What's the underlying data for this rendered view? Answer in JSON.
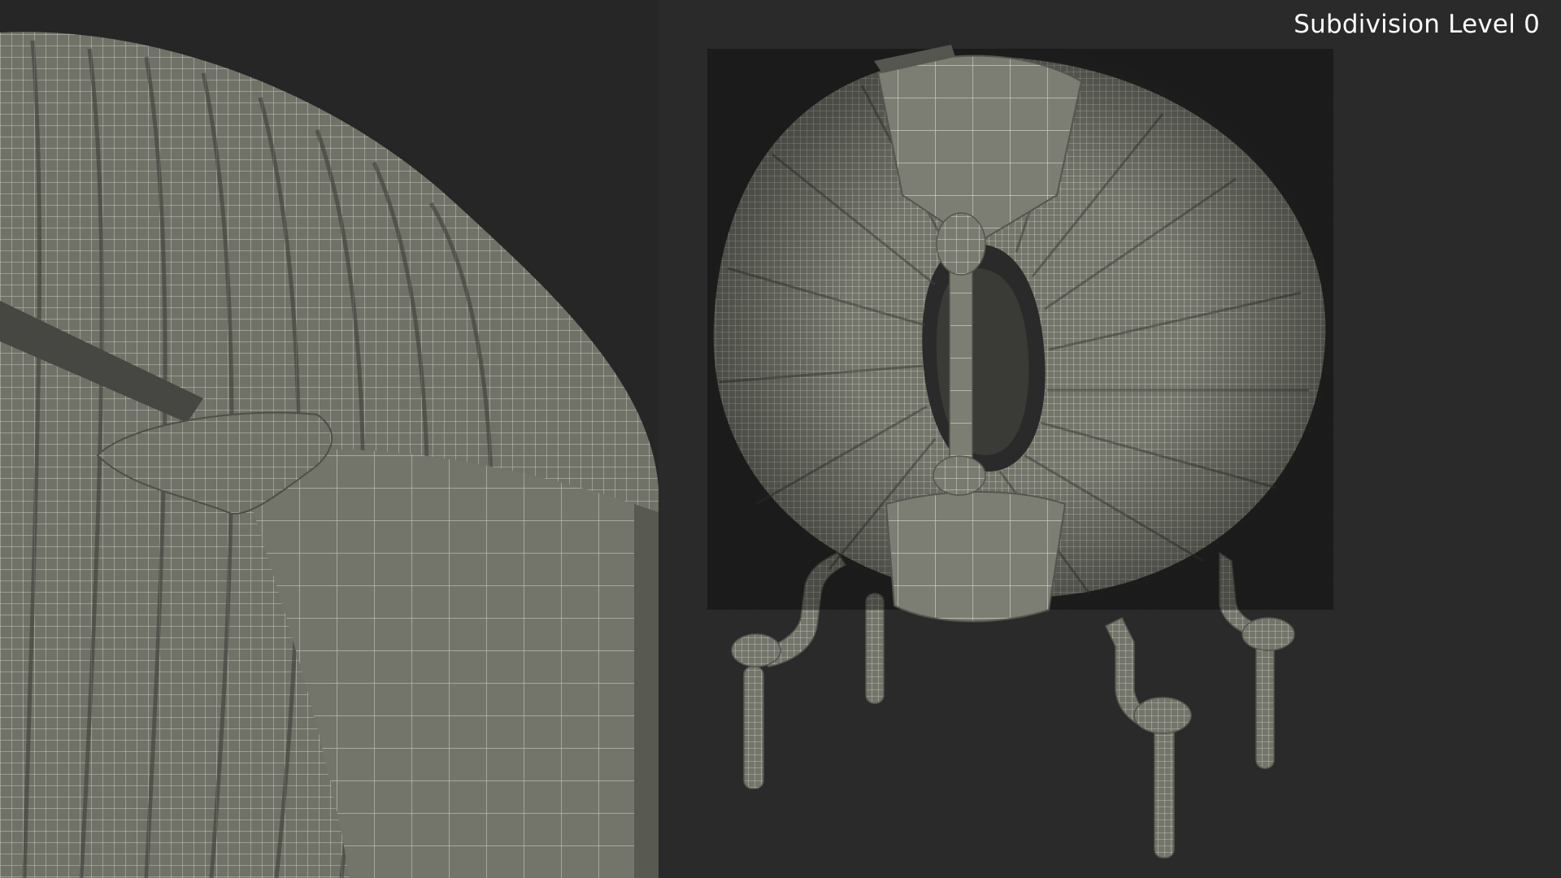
{
  "overlay": {
    "subdivision_label": "Subdivision Level 0"
  },
  "scene": {
    "subject": "toroidal-inductor-wireframe",
    "views": [
      "closeup-view",
      "full-view"
    ]
  },
  "colors": {
    "background": "#2a2a2a",
    "mesh_surface": "#7a7b70",
    "mesh_shadow": "#55564f",
    "wire_lines": "#e8e8e0"
  }
}
